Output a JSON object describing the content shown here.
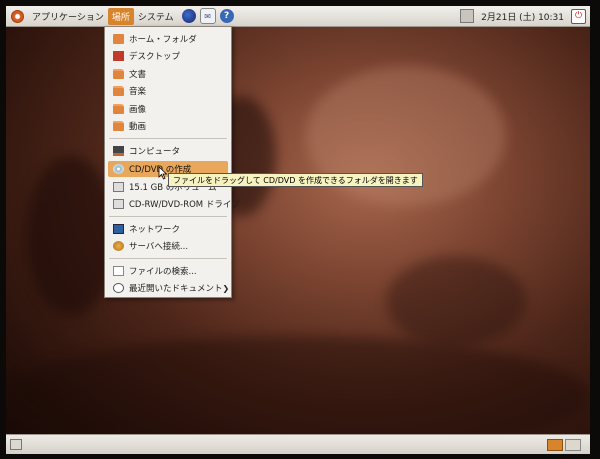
{
  "top_panel": {
    "menus": [
      "アプリケーション",
      "場所",
      "システム"
    ],
    "active_menu": "場所",
    "clock": "2月21日 (土)  10:31"
  },
  "places_menu": {
    "items": [
      {
        "label": "ホーム・フォルダ",
        "icon": "home-folder-icon"
      },
      {
        "label": "デスクトップ",
        "icon": "desktop-icon"
      },
      {
        "label": "文書",
        "icon": "folder-icon"
      },
      {
        "label": "音楽",
        "icon": "folder-icon"
      },
      {
        "label": "画像",
        "icon": "folder-icon"
      },
      {
        "label": "動画",
        "icon": "folder-icon"
      },
      {
        "label": "コンピュータ",
        "icon": "computer-icon"
      },
      {
        "label": "CD/DVD の作成",
        "icon": "cd-burner-icon"
      },
      {
        "label": "15.1 GB のボリューム",
        "icon": "drive-icon"
      },
      {
        "label": "CD-RW/DVD-ROM ドライブ",
        "icon": "optical-drive-icon"
      },
      {
        "label": "ネットワーク",
        "icon": "network-icon"
      },
      {
        "label": "サーバへ接続...",
        "icon": "server-icon"
      },
      {
        "label": "ファイルの検索...",
        "icon": "search-icon"
      },
      {
        "label": "最近開いたドキュメント",
        "icon": "recent-documents-icon"
      }
    ],
    "highlighted_item": "CD/DVD の作成"
  },
  "tooltip": "ファイルをドラッグして CD/DVD を作成できるフォルダを開きます",
  "accent_color": "#d8842c"
}
